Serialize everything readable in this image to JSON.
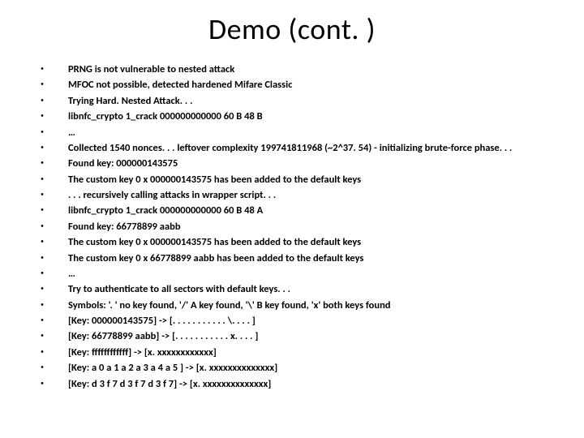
{
  "title": "Demo (cont. )",
  "lines": [
    "PRNG is not vulnerable to nested attack",
    "MFOC not possible, detected hardened Mifare Classic",
    "Trying Hard. Nested Attack. . .",
    "libnfc_crypto 1_crack 000000000000 60 B 48 B",
    "…",
    "Collected 1540 nonces. . . leftover complexity 199741811968 (~2^37. 54) - initializing brute-force phase. . .",
    "Found key: 000000143575",
    "The custom key 0 x 000000143575 has been added to the default keys",
    " . . . recursively calling attacks in wrapper script. . .",
    "libnfc_crypto 1_crack 000000000000 60 B 48 A",
    "Found key: 66778899 aabb",
    "The custom key 0 x 000000143575 has been added to the default keys",
    "The custom key 0 x 66778899 aabb has been added to the default keys",
    "…",
    "Try to authenticate to all sectors with default keys. . .",
    "Symbols: '. ' no key found, '/' A key found, '\\' B key found, 'x' both keys found",
    "[Key: 000000143575] -> [. . . . . . . . . . . \\. . . . ]",
    "[Key: 66778899 aabb] -> [. . . . . . . . . . . x. . . . ]",
    "[Key: ffffffffffff] -> [x. xxxxxxxxxxxx]",
    "[Key: a 0 a 1 a 2 a 3 a 4 a 5 ] -> [x. xxxxxxxxxxxxxx]",
    "[Key: d 3 f 7 d 3 f 7 d 3 f 7] -> [x. xxxxxxxxxxxxxx]"
  ]
}
